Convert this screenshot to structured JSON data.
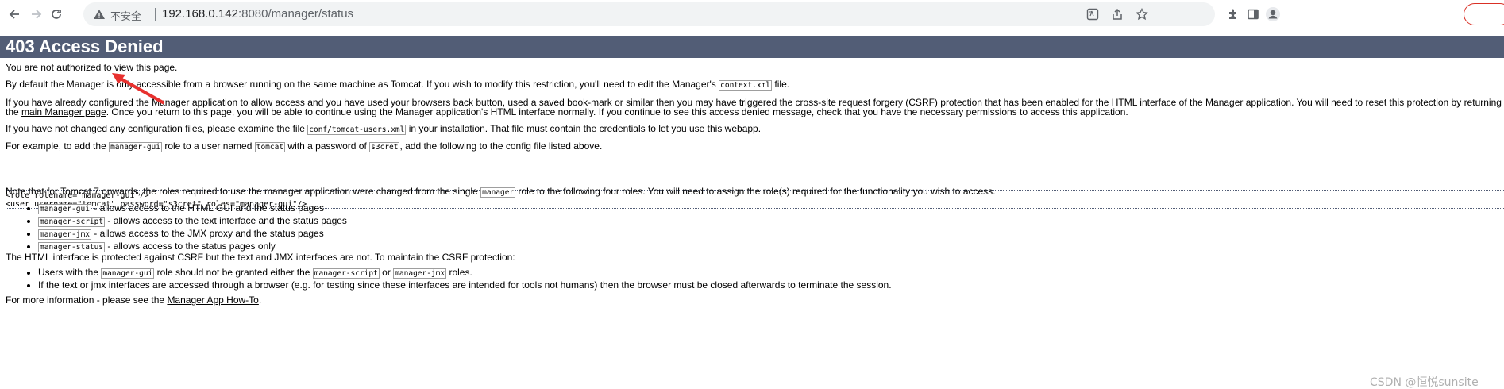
{
  "browser": {
    "insecure_label": "不安全",
    "url_host": "192.168.0.142",
    "url_rest": ":8080/manager/status",
    "icons": [
      "back-icon",
      "forward-icon",
      "reload-icon",
      "warning-icon",
      "translate-icon",
      "share-icon",
      "bookmark-star-icon",
      "extensions-icon",
      "side-panel-icon",
      "profile-icon"
    ]
  },
  "page": {
    "title": "403 Access Denied",
    "p1": "You are not authorized to view this page.",
    "p2_before": "By default the Manager is only accessible from a browser running on the same machine as Tomcat. If you wish to modify this restriction, you'll need to edit the Manager's ",
    "p2_code": "context.xml",
    "p2_after": " file.",
    "p3_line1": "If you have already configured the Manager application to allow access and you have used your browsers back button, used a saved book-mark or similar then you may have triggered the cross-site request forgery (CSRF) protection that has been enabled for the HTML interface of the Manager application. You will need to reset this protection by returning",
    "p3_line2_before": "the ",
    "p3_link": "main Manager page",
    "p3_line2_after": ". Once you return to this page, you will be able to continue using the Manager application's HTML interface normally. If you continue to see this access denied message, check that you have the necessary permissions to access this application.",
    "p4_before": "If you have not changed any configuration files, please examine the file ",
    "p4_code": "conf/tomcat-users.xml",
    "p4_after": " in your installation. That file must contain the credentials to let you use this webapp.",
    "p5_a": "For example, to add the ",
    "p5_code1": "manager-gui",
    "p5_b": " role to a user named ",
    "p5_code2": "tomcat",
    "p5_c": " with a password of ",
    "p5_code3": "s3cret",
    "p5_d": ", add the following to the config file listed above.",
    "pre_line1": "<role rolename=\"manager-gui\"/>",
    "pre_line2": "<user username=\"tomcat\" password=\"s3cret\" roles=\"manager-gui\"/>",
    "p6_before": "Note that for Tomcat 7 onwards, the roles required to use the manager application were changed from the single ",
    "p6_code": "manager",
    "p6_after": " role to the following four roles. You will need to assign the role(s) required for the functionality you wish to access.",
    "roles": [
      {
        "code": "manager-gui",
        "text": " - allows access to the HTML GUI and the status pages"
      },
      {
        "code": "manager-script",
        "text": " - allows access to the text interface and the status pages"
      },
      {
        "code": "manager-jmx",
        "text": " - allows access to the JMX proxy and the status pages"
      },
      {
        "code": "manager-status",
        "text": " - allows access to the status pages only"
      }
    ],
    "p7": "The HTML interface is protected against CSRF but the text and JMX interfaces are not. To maintain the CSRF protection:",
    "csrf1_a": "Users with the ",
    "csrf1_code1": "manager-gui",
    "csrf1_b": " role should not be granted either the ",
    "csrf1_code2": "manager-script",
    "csrf1_c": " or ",
    "csrf1_code3": "manager-jmx",
    "csrf1_d": " roles.",
    "csrf2": "If the text or jmx interfaces are accessed through a browser (e.g. for testing since these interfaces are intended for tools not humans) then the browser must be closed afterwards to terminate the session.",
    "p8_before": "For more information - please see the ",
    "p8_link": "Manager App How-To",
    "p8_after": "."
  },
  "watermark": "CSDN @恒悦sunsite",
  "colors": {
    "header_bg": "#525d76",
    "arrow": "#e8312f"
  }
}
